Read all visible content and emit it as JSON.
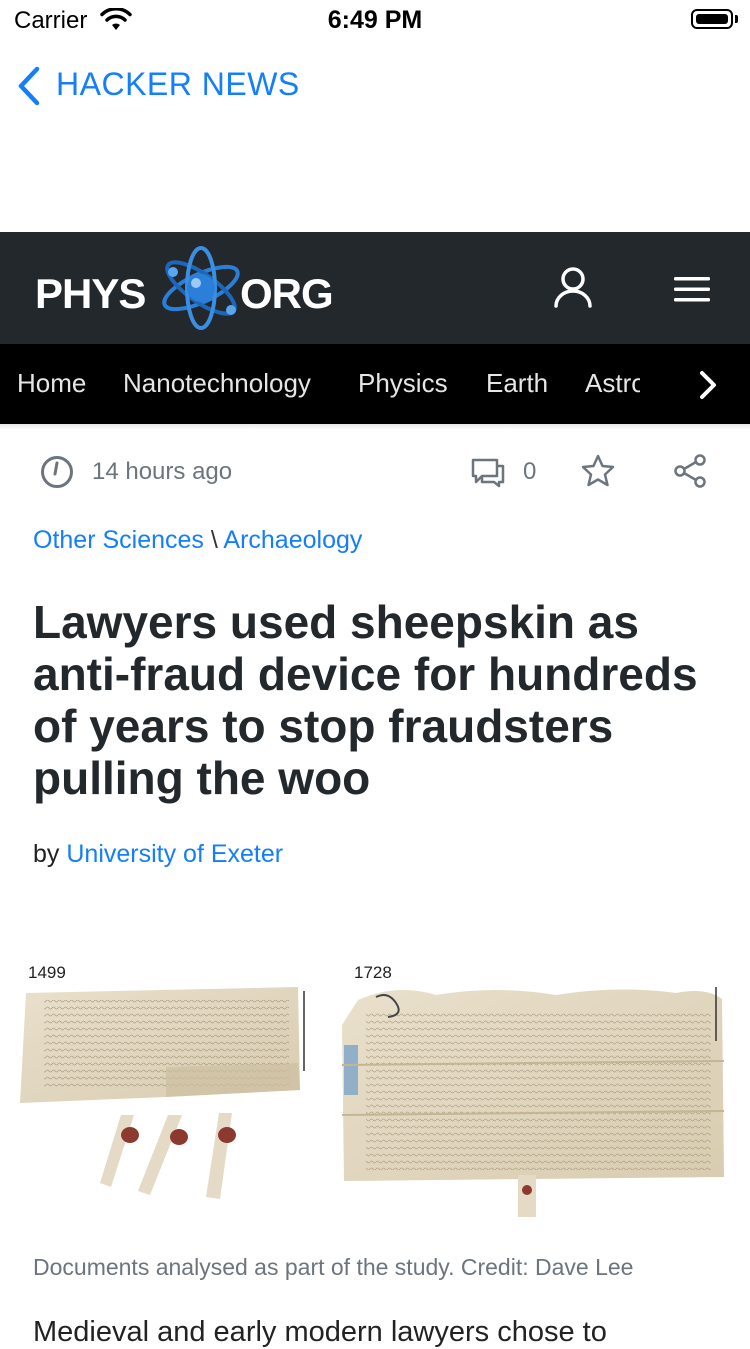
{
  "status_bar": {
    "carrier": "Carrier",
    "time": "6:49 PM"
  },
  "nav": {
    "back_label": "HACKER NEWS"
  },
  "site": {
    "logo_left": "PHYS",
    "logo_right": "ORG",
    "accent": "#147EFB",
    "header_bg": "#23282d"
  },
  "categories": [
    "Home",
    "Nanotechnology",
    "Physics",
    "Earth",
    "Astro"
  ],
  "meta": {
    "time_ago": "14 hours ago",
    "comment_count": "0"
  },
  "breadcrumb": {
    "parent": "Other Sciences",
    "separator": "\\",
    "child": "Archaeology"
  },
  "article": {
    "title": "Lawyers used sheepskin as anti-fraud device for hundreds of years to stop fraudsters pulling the woo",
    "by_prefix": "by",
    "author": "University of Exeter",
    "figure_label_left": "1499",
    "figure_label_right": "1728",
    "caption": "Documents analysed as part of the study. Credit: Dave Lee",
    "body_start": "Medieval and early modern lawyers chose to"
  }
}
